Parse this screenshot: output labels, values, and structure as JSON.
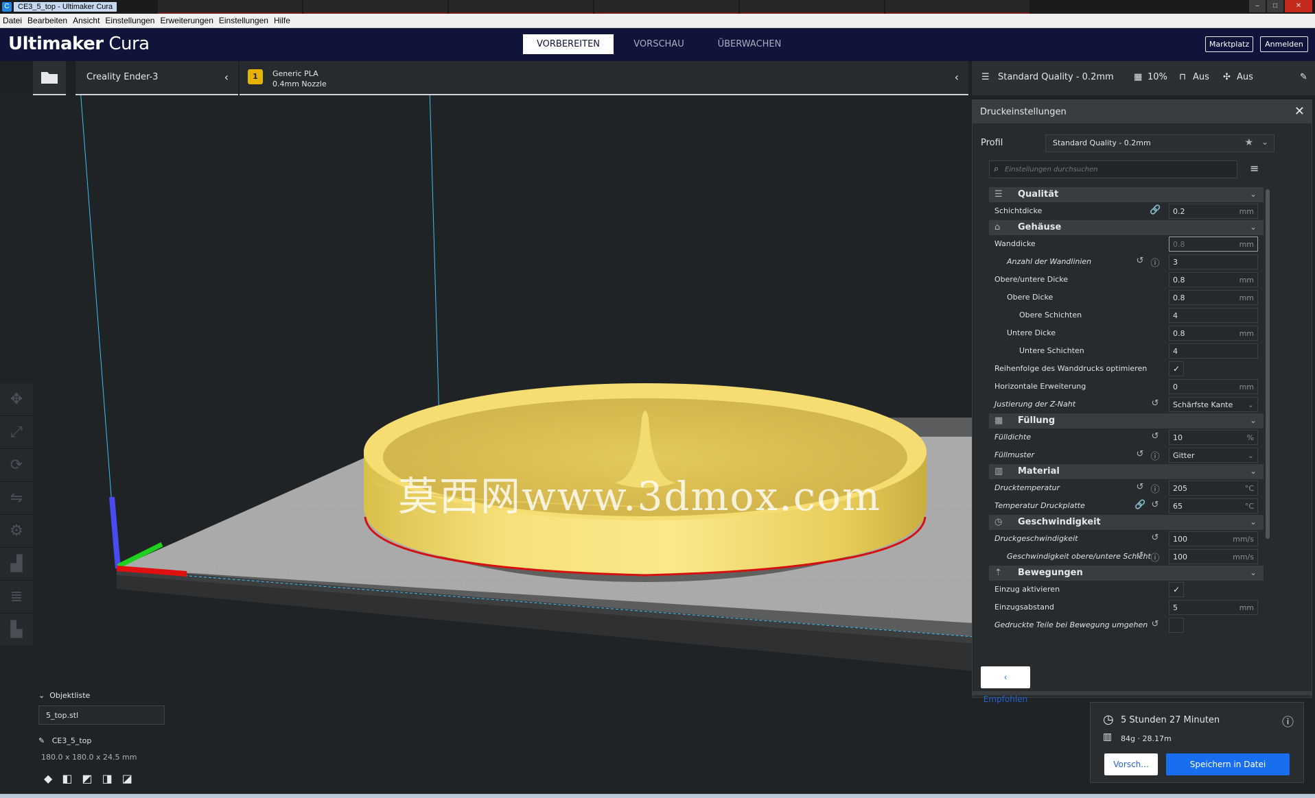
{
  "window": {
    "title": "CE3_5_top - Ultimaker Cura"
  },
  "menu": [
    "Datei",
    "Bearbeiten",
    "Ansicht",
    "Einstellungen",
    "Erweiterungen",
    "Einstellungen",
    "Hilfe"
  ],
  "header": {
    "logo_bold": "Ultimaker",
    "logo_thin": " Cura",
    "stages": [
      "VORBEREITEN",
      "VORSCHAU",
      "ÜBERWACHEN"
    ],
    "marketplace": "Marktplatz",
    "signin": "Anmelden"
  },
  "toolbar": {
    "printer": "Creality Ender-3",
    "material_line1": "Generic PLA",
    "material_line2": "0.4mm Nozzle",
    "material_badge": "1",
    "quality": "Standard Quality - 0.2mm",
    "infill": "10%",
    "support": "Aus",
    "adhesion": "Aus"
  },
  "panel": {
    "title": "Druckeinstellungen",
    "profile_label": "Profil",
    "profile_value": "Standard Quality - 0.2mm",
    "search_placeholder": "Einstellungen durchsuchen",
    "recommended": "Empfohlen"
  },
  "settings": [
    {
      "type": "cat",
      "icon": "quality-icon",
      "glyph": "☰",
      "label": "Qualität"
    },
    {
      "type": "row",
      "indent": 0,
      "italic": false,
      "label": "Schichtdicke",
      "value": "0.2",
      "unit": "mm",
      "icons": [
        "🔗"
      ]
    },
    {
      "type": "cat",
      "icon": "shell-icon",
      "glyph": "⌂",
      "label": "Gehäuse"
    },
    {
      "type": "row",
      "indent": 0,
      "italic": false,
      "label": "Wanddicke",
      "value": "0.8",
      "unit": "mm",
      "dim": true,
      "hl": true
    },
    {
      "type": "row",
      "indent": 1,
      "italic": true,
      "label": "Anzahl der Wandlinien",
      "value": "3",
      "unit": "",
      "icons": [
        "↺",
        "ⓘ"
      ]
    },
    {
      "type": "row",
      "indent": 0,
      "italic": false,
      "label": "Obere/untere Dicke",
      "value": "0.8",
      "unit": "mm"
    },
    {
      "type": "row",
      "indent": 1,
      "italic": false,
      "label": "Obere Dicke",
      "value": "0.8",
      "unit": "mm"
    },
    {
      "type": "row",
      "indent": 2,
      "italic": false,
      "label": "Obere Schichten",
      "value": "4",
      "unit": ""
    },
    {
      "type": "row",
      "indent": 1,
      "italic": false,
      "label": "Untere Dicke",
      "value": "0.8",
      "unit": "mm"
    },
    {
      "type": "row",
      "indent": 2,
      "italic": false,
      "label": "Untere Schichten",
      "value": "4",
      "unit": ""
    },
    {
      "type": "check",
      "indent": 0,
      "italic": false,
      "label": "Reihenfolge des Wanddrucks optimieren",
      "checked": "✓"
    },
    {
      "type": "row",
      "indent": 0,
      "italic": false,
      "label": "Horizontale Erweiterung",
      "value": "0",
      "unit": "mm"
    },
    {
      "type": "row",
      "indent": 0,
      "italic": true,
      "label": "Justierung der Z-Naht",
      "value": "Schärfste Kante",
      "unit": "⌄",
      "icons": [
        "↺"
      ]
    },
    {
      "type": "cat",
      "icon": "infill-icon",
      "glyph": "▦",
      "label": "Füllung"
    },
    {
      "type": "row",
      "indent": 0,
      "italic": true,
      "label": "Fülldichte",
      "value": "10",
      "unit": "%",
      "icons": [
        "↺"
      ]
    },
    {
      "type": "row",
      "indent": 0,
      "italic": true,
      "label": "Füllmuster",
      "value": "Gitter",
      "unit": "⌄",
      "icons": [
        "↺",
        "ⓘ"
      ]
    },
    {
      "type": "cat",
      "icon": "material-icon",
      "glyph": "▥",
      "label": "Material"
    },
    {
      "type": "row",
      "indent": 0,
      "italic": true,
      "label": "Drucktemperatur",
      "value": "205",
      "unit": "°C",
      "icons": [
        "↺",
        "ⓘ"
      ]
    },
    {
      "type": "row",
      "indent": 0,
      "italic": true,
      "label": "Temperatur Druckplatte",
      "value": "65",
      "unit": "°C",
      "icons": [
        "🔗",
        "↺"
      ]
    },
    {
      "type": "cat",
      "icon": "speed-icon",
      "glyph": "◷",
      "label": "Geschwindigkeit"
    },
    {
      "type": "row",
      "indent": 0,
      "italic": true,
      "label": "Druckgeschwindigkeit",
      "value": "100",
      "unit": "mm/s",
      "icons": [
        "↺"
      ]
    },
    {
      "type": "row",
      "indent": 1,
      "italic": true,
      "label": "Geschwindigkeit obere/untere Schicht",
      "value": "100",
      "unit": "mm/s",
      "icons": [
        "↺",
        "ⓘ"
      ]
    },
    {
      "type": "cat",
      "icon": "travel-icon",
      "glyph": "⇡",
      "label": "Bewegungen"
    },
    {
      "type": "check",
      "indent": 0,
      "italic": false,
      "label": "Einzug aktivieren",
      "checked": "✓"
    },
    {
      "type": "row",
      "indent": 0,
      "italic": false,
      "label": "Einzugsabstand",
      "value": "5",
      "unit": "mm"
    },
    {
      "type": "check",
      "indent": 0,
      "italic": true,
      "label": "Gedruckte Teile bei Bewegung umgehen",
      "checked": "",
      "icons": [
        "↺"
      ]
    }
  ],
  "objects": {
    "toggle_label": "Objektliste",
    "file": "5_top.stl",
    "name": "CE3_5_top",
    "dims": "180.0 x 180.0 x 24.5 mm"
  },
  "summary": {
    "time": "5 Stunden 27 Minuten",
    "material": "84g · 28.17m",
    "preview": "Vorsch...",
    "save": "Speichern in Datei"
  },
  "watermark": "莫西网www.3dmox.com",
  "colors": {
    "header": "#10143a",
    "accent": "#196ef0",
    "model": "#f2d86a"
  }
}
